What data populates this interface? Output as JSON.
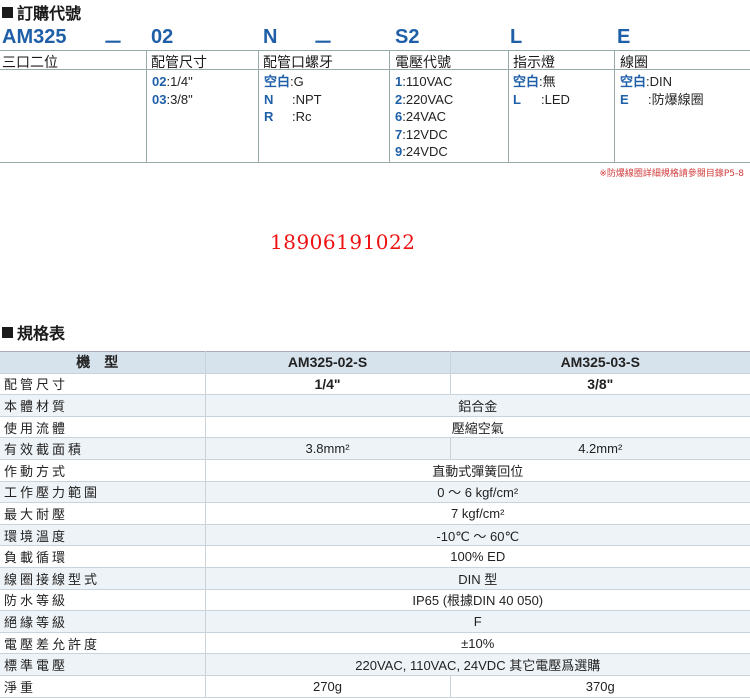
{
  "order": {
    "title": "訂購代號",
    "code": [
      "AM325",
      "－",
      "02",
      "N",
      "－",
      "S2",
      "L",
      "E"
    ],
    "headers": [
      "三口二位",
      "配管尺寸",
      "配管口螺牙",
      "電壓代號",
      "指示燈",
      "線圈"
    ],
    "pipe_size": [
      {
        "k": "02",
        "v": ":1/4\""
      },
      {
        "k": "03",
        "v": ":3/8\""
      }
    ],
    "thread": [
      {
        "k": "空白",
        "v": ":G"
      },
      {
        "k": "N",
        "v": ":NPT"
      },
      {
        "k": "R",
        "v": ":Rc"
      }
    ],
    "voltage": [
      {
        "k": "1",
        "v": ":110VAC"
      },
      {
        "k": "2",
        "v": ":220VAC"
      },
      {
        "k": "6",
        "v": ":24VAC"
      },
      {
        "k": "7",
        "v": ":12VDC"
      },
      {
        "k": "9",
        "v": ":24VDC"
      }
    ],
    "indicator": [
      {
        "k": "空白",
        "v": ":無"
      },
      {
        "k": "L",
        "v": ":LED"
      }
    ],
    "coil": [
      {
        "k": "空白",
        "v": ":DIN"
      },
      {
        "k": "E",
        "v": ":防爆線圈"
      }
    ],
    "note": "※防爆線圈詳細規格請參閱目錄P5-8"
  },
  "phone": "18906191022",
  "spec": {
    "title": "規格表",
    "header": {
      "label": "機型",
      "col1": "AM325-02-S",
      "col2": "AM325-03-S"
    },
    "rows": [
      {
        "label": "配管尺寸",
        "v1": "1/4\"",
        "v2": "3/8\"",
        "bold": true
      },
      {
        "label": "本體材質",
        "v": "鋁合金"
      },
      {
        "label": "使用流體",
        "v": "壓縮空氣"
      },
      {
        "label": "有效截面積",
        "v1": "3.8mm²",
        "v2": "4.2mm²"
      },
      {
        "label": "作動方式",
        "v": "直動式彈簧回位"
      },
      {
        "label": "工作壓力範圍",
        "v": "0 ～ 6 kgf/cm²"
      },
      {
        "label": "最大耐壓",
        "v": "7 kgf/cm²"
      },
      {
        "label": "環境溫度",
        "v": "-10℃ ～ 60℃"
      },
      {
        "label": "負載循環",
        "v": "100% ED"
      },
      {
        "label": "線圈接線型式",
        "v": "DIN 型"
      },
      {
        "label": "防水等級",
        "v": "IP65 (根據DIN 40 050)"
      },
      {
        "label": "絕緣等級",
        "v": "F"
      },
      {
        "label": "電壓差允許度",
        "v": "±10%"
      },
      {
        "label": "標準電壓",
        "v": "220VAC, 110VAC, 24VDC 其它電壓爲選購"
      },
      {
        "label": "淨重",
        "v1": "270g",
        "v2": "370g"
      }
    ]
  }
}
